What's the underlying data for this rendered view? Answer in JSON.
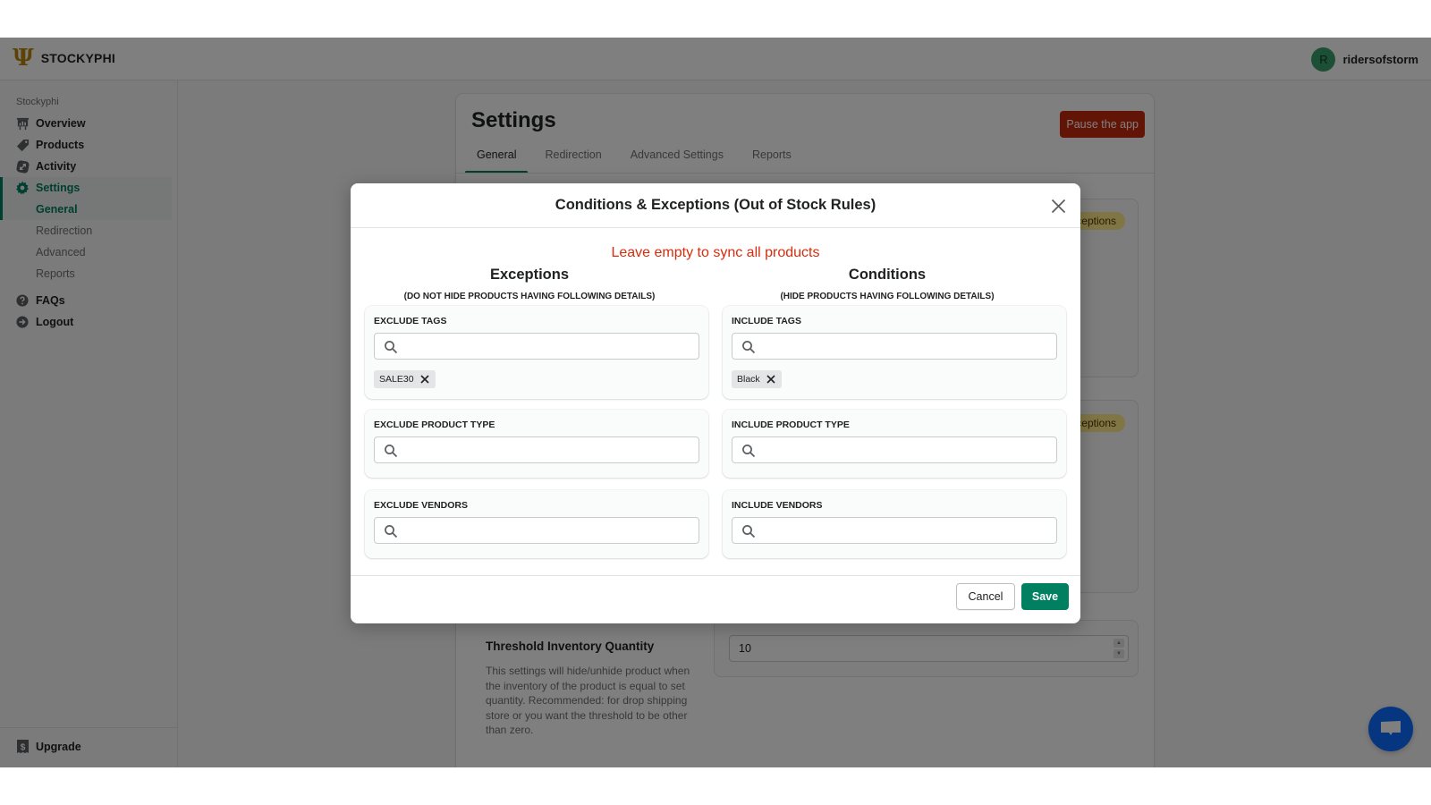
{
  "app": {
    "brand": "STOCKYPHI",
    "user": {
      "initial": "R",
      "name": "ridersofstorm"
    }
  },
  "sidebar": {
    "section": "Stockyphi",
    "items": [
      {
        "label": "Overview",
        "icon": "chart-icon"
      },
      {
        "label": "Products",
        "icon": "tag-icon"
      },
      {
        "label": "Activity",
        "icon": "activity-icon"
      },
      {
        "label": "Settings",
        "icon": "gear-icon"
      }
    ],
    "sub_items": [
      {
        "label": "General"
      },
      {
        "label": "Redirection"
      },
      {
        "label": "Advanced"
      },
      {
        "label": "Reports"
      }
    ],
    "bottom_items": [
      {
        "label": "FAQs",
        "icon": "question-icon"
      },
      {
        "label": "Logout",
        "icon": "logout-icon"
      }
    ],
    "upgrade": {
      "label": "Upgrade",
      "icon": "dollar-icon"
    }
  },
  "settings_page": {
    "title": "Settings",
    "pause_button": "Pause the app",
    "tabs": [
      "General",
      "Redirection",
      "Advanced Settings",
      "Reports"
    ],
    "active_tab": "General",
    "badge_text": "Exceptions",
    "threshold": {
      "title": "Threshold Inventory Quantity",
      "description": "This settings will hide/unhide product when the inventory of the product is equal to set quantity. Recommended: for drop shipping store or you want the threshold to be other than zero.",
      "value": "10"
    }
  },
  "modal": {
    "title": "Conditions & Exceptions (Out of Stock Rules)",
    "hint": "Leave empty to sync all products",
    "exceptions": {
      "title": "Exceptions",
      "subtitle": "(DO NOT HIDE PRODUCTS HAVING FOLLOWING DETAILS)",
      "fields": [
        {
          "label": "EXCLUDE TAGS",
          "value": "",
          "placeholder": "",
          "tags": [
            "SALE30"
          ]
        },
        {
          "label": "EXCLUDE PRODUCT TYPE",
          "value": "",
          "placeholder": "",
          "tags": []
        },
        {
          "label": "EXCLUDE VENDORS",
          "value": "",
          "placeholder": "",
          "tags": []
        }
      ]
    },
    "conditions": {
      "title": "Conditions",
      "subtitle": "(HIDE PRODUCTS HAVING FOLLOWING DETAILS)",
      "fields": [
        {
          "label": "INCLUDE TAGS",
          "value": "",
          "placeholder": "",
          "tags": [
            "Black"
          ]
        },
        {
          "label": "INCLUDE PRODUCT TYPE",
          "value": "",
          "placeholder": "",
          "tags": []
        },
        {
          "label": "INCLUDE VENDORS",
          "value": "",
          "placeholder": "",
          "tags": []
        }
      ]
    },
    "cancel_label": "Cancel",
    "save_label": "Save"
  },
  "colors": {
    "primary": "#008060",
    "danger": "#c5280c",
    "hint": "#d72c0d",
    "chat": "#0a6cff"
  }
}
